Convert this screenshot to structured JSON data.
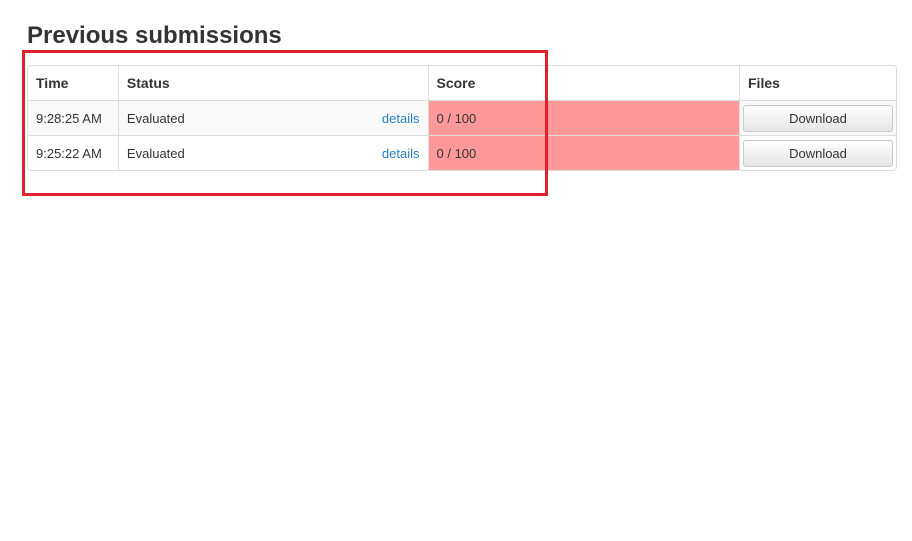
{
  "page": {
    "title": "Previous submissions"
  },
  "table": {
    "headers": {
      "time": "Time",
      "status": "Status",
      "score": "Score",
      "files": "Files"
    },
    "rows": [
      {
        "time": "9:28:25 AM",
        "status": "Evaluated",
        "details": "details",
        "score": "0 / 100",
        "download": "Download"
      },
      {
        "time": "9:25:22 AM",
        "status": "Evaluated",
        "details": "details",
        "score": "0 / 100",
        "download": "Download"
      }
    ]
  },
  "colors": {
    "score_fail": "#ff9999",
    "link": "#2a7fc1",
    "highlight": "#e0202a"
  }
}
